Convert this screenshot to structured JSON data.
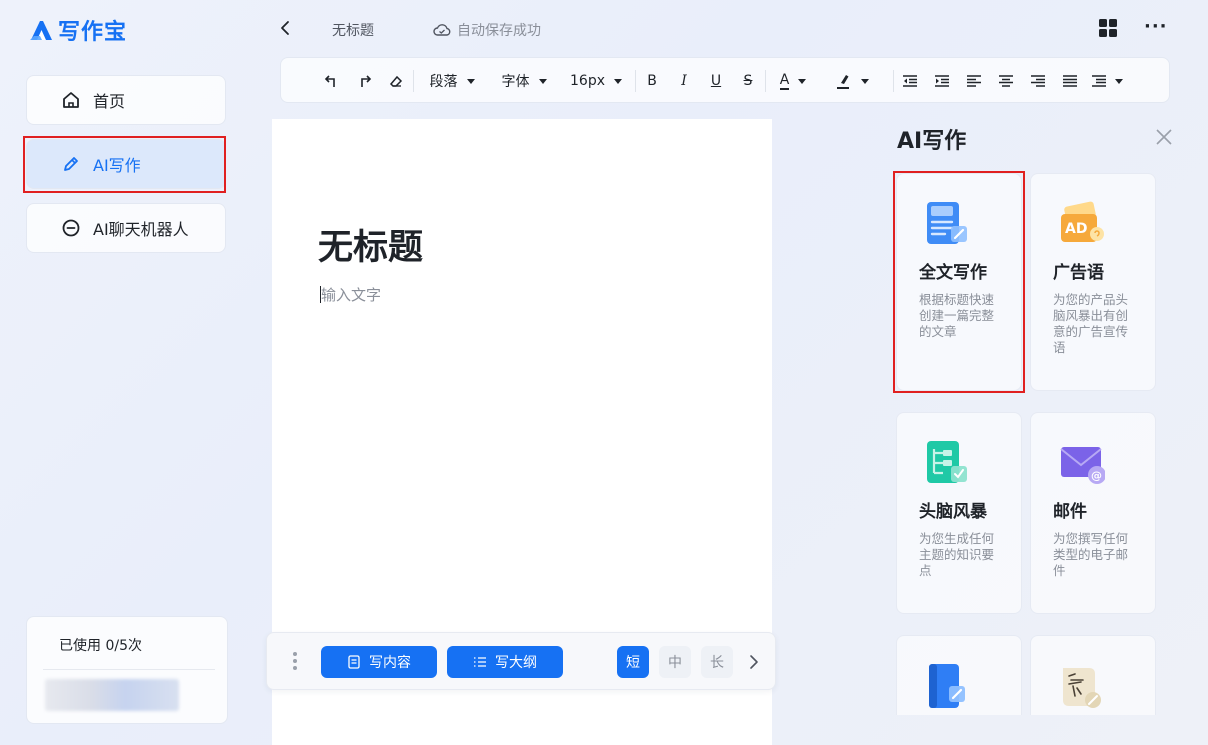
{
  "app": {
    "name": "写作宝"
  },
  "sidebar": {
    "items": [
      {
        "label": "首页"
      },
      {
        "label": "AI写作"
      },
      {
        "label": "AI聊天机器人"
      }
    ],
    "usage_text": "已使用 0/5次"
  },
  "header": {
    "doc_title": "无标题",
    "save_status": "自动保存成功"
  },
  "toolbar": {
    "paragraph": "段落",
    "font": "字体",
    "size": "16px",
    "bold": "B",
    "italic": "I",
    "underline": "U",
    "strike": "S",
    "font_color": "A"
  },
  "editor": {
    "title": "无标题",
    "placeholder": "输入文字"
  },
  "write_bar": {
    "write_content": "写内容",
    "write_outline": "写大纲",
    "lengths": [
      "短",
      "中",
      "长"
    ],
    "selected_length": "短"
  },
  "ai_panel": {
    "title": "AI写作",
    "cards": [
      {
        "title": "全文写作",
        "desc": "根据标题快速创建一篇完整的文章",
        "icon": "document-icon"
      },
      {
        "title": "广告语",
        "desc": "为您的产品头脑风暴出有创意的广告宣传语",
        "icon": "ad-icon"
      },
      {
        "title": "头脑风暴",
        "desc": "为您生成任何主题的知识要点",
        "icon": "mindmap-icon"
      },
      {
        "title": "邮件",
        "desc": "为您撰写任何类型的电子邮件",
        "icon": "mail-icon"
      },
      {
        "title": "",
        "desc": "",
        "icon": "book-icon"
      },
      {
        "title": "",
        "desc": "",
        "icon": "poem-icon"
      }
    ]
  },
  "colors": {
    "accent": "#1671f3",
    "highlight": "#e02020"
  }
}
